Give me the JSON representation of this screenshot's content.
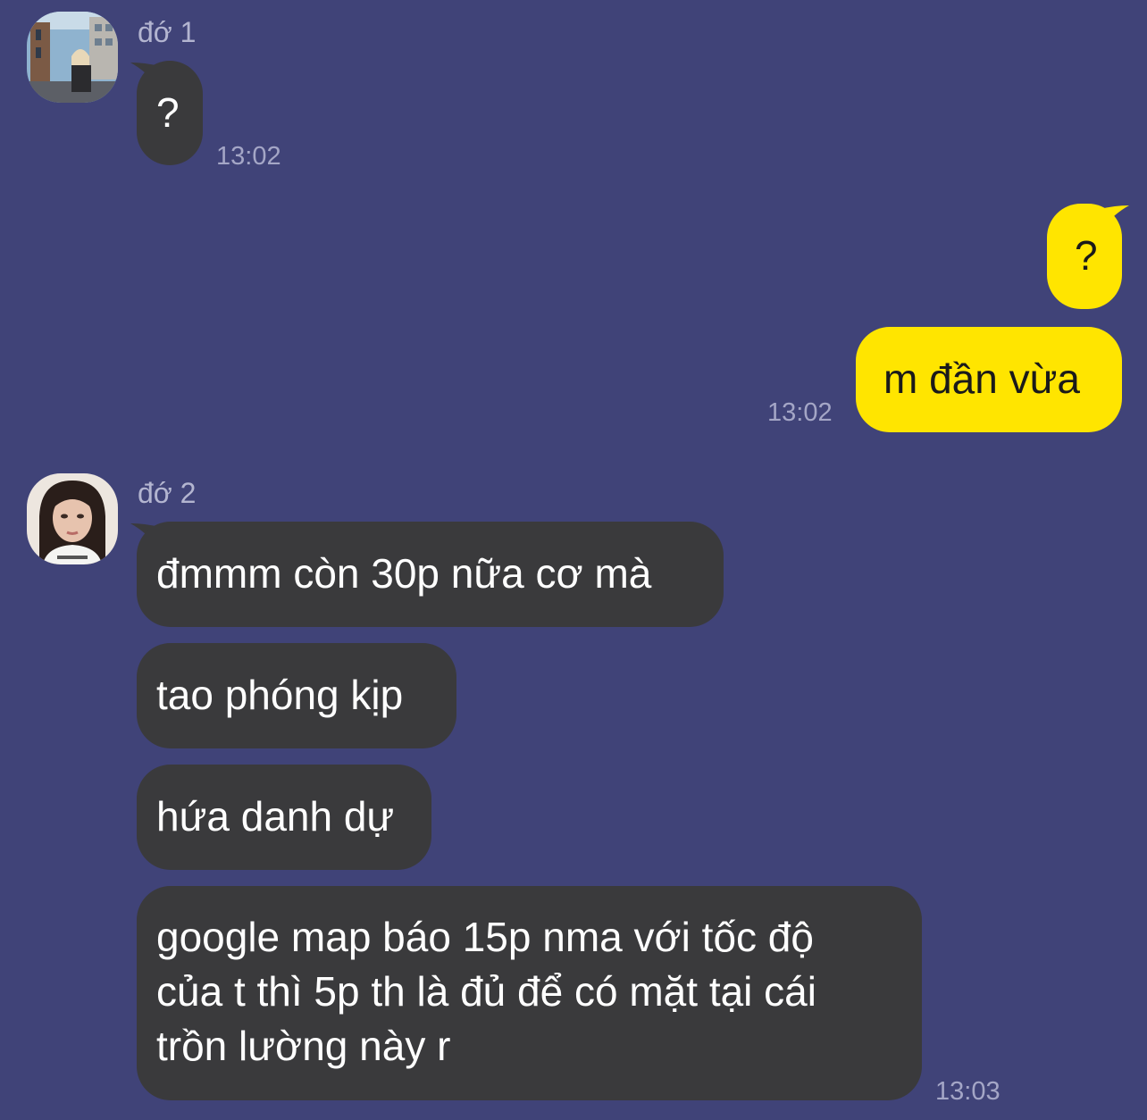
{
  "senders": {
    "first": {
      "name": "đớ 1"
    },
    "second": {
      "name": "đớ 2"
    }
  },
  "messages": {
    "incoming_1": {
      "text": "?",
      "time": "13:02"
    },
    "outgoing_1": {
      "text": "?"
    },
    "outgoing_2": {
      "text": "m đần vừa",
      "time": "13:02"
    },
    "incoming_2": {
      "text": "đmmm còn 30p nữa cơ mà"
    },
    "incoming_3": {
      "text": "tao phóng kịp"
    },
    "incoming_4": {
      "text": "hứa danh dự"
    },
    "incoming_5": {
      "lines": [
        "google map báo 15p nma với tốc độ",
        "của t thì 5p th là đủ để có mặt tại cái",
        "trồn lường này r"
      ],
      "time": "13:03"
    }
  },
  "colors": {
    "background": "#404378",
    "incoming_bubble": "#3A3A3C",
    "outgoing_bubble": "#FFE500",
    "timestamp": "#A4A6C6",
    "sender_name": "#B3B5D0"
  },
  "icons": {
    "sender_1_avatar": "avatar-street-photo",
    "sender_2_avatar": "avatar-portrait-photo"
  }
}
